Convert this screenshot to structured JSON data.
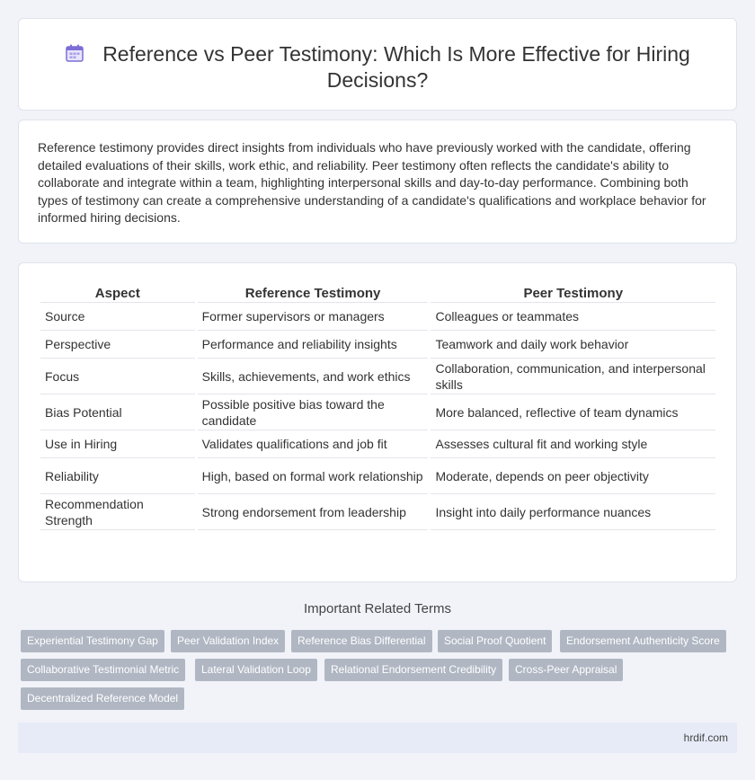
{
  "header": {
    "title": "Reference vs Peer Testimony: Which Is More Effective for Hiring Decisions?",
    "icon": "calendar-icon",
    "icon_color": "#7b6fd6"
  },
  "intro": {
    "text": "Reference testimony provides direct insights from individuals who have previously worked with the candidate, offering detailed evaluations of their skills, work ethic, and reliability. Peer testimony often reflects the candidate's ability to collaborate and integrate within a team, highlighting interpersonal skills and day-to-day performance. Combining both types of testimony can create a comprehensive understanding of a candidate's qualifications and workplace behavior for informed hiring decisions."
  },
  "table": {
    "headers": [
      "Aspect",
      "Reference Testimony",
      "Peer Testimony"
    ],
    "rows": [
      [
        "Source",
        "Former supervisors or managers",
        "Colleagues or teammates"
      ],
      [
        "Perspective",
        "Performance and reliability insights",
        "Teamwork and daily work behavior"
      ],
      [
        "Focus",
        "Skills, achievements, and work ethics",
        "Collaboration, communication, and interpersonal skills"
      ],
      [
        "Bias Potential",
        "Possible positive bias toward the candidate",
        "More balanced, reflective of team dynamics"
      ],
      [
        "Use in Hiring",
        "Validates qualifications and job fit",
        "Assesses cultural fit and working style"
      ],
      [
        "Reliability",
        "High, based on formal work relationship",
        "Moderate, depends on peer objectivity"
      ],
      [
        "Recommendation Strength",
        "Strong endorsement from leadership",
        "Insight into daily performance nuances"
      ]
    ]
  },
  "related": {
    "title": "Important Related Terms",
    "tags": [
      "Experiential Testimony Gap",
      "Peer Validation Index",
      "Reference Bias Differential",
      "Social Proof Quotient",
      "Endorsement Authenticity Score",
      "Collaborative Testimonial Metric",
      "Lateral Validation Loop",
      "Relational Endorsement Credibility",
      "Cross-Peer Appraisal",
      "Decentralized Reference Model"
    ],
    "tag_color": "#b0b7c3"
  },
  "footer": {
    "site": "hrdif.com"
  }
}
